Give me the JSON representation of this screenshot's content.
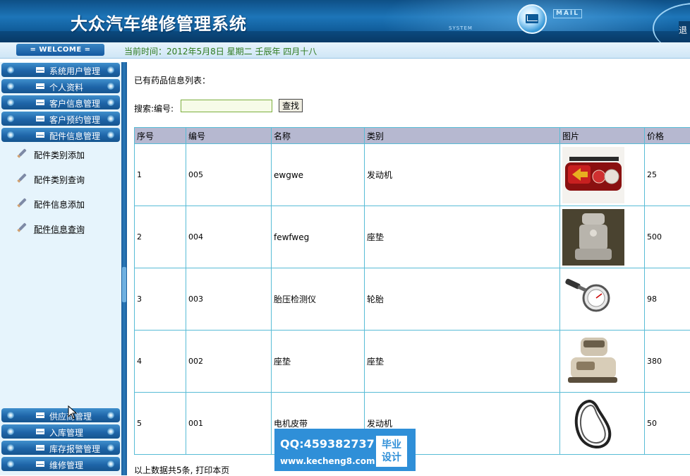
{
  "header": {
    "app_title": "大众汽车维修管理系统",
    "system_tag": "SYSTEM",
    "mail_tag": "MAIL",
    "right_tab": "退"
  },
  "status_bar": {
    "welcome": "= WELCOME =",
    "current_time": "当前时间：2012年5月8日  星期二  壬辰年  四月十八"
  },
  "sidebar": {
    "menu_top": [
      {
        "label": "系统用户管理"
      },
      {
        "label": "个人资料"
      },
      {
        "label": "客户信息管理"
      },
      {
        "label": "客户预约管理"
      },
      {
        "label": "配件信息管理"
      }
    ],
    "submenu": [
      {
        "label": "配件类别添加"
      },
      {
        "label": "配件类别查询"
      },
      {
        "label": "配件信息添加"
      },
      {
        "label": "配件信息查询"
      }
    ],
    "menu_bottom": [
      {
        "label": "供应商管理"
      },
      {
        "label": "入库管理"
      },
      {
        "label": "库存报警管理"
      },
      {
        "label": "维修管理"
      }
    ]
  },
  "content": {
    "list_title": "已有药品信息列表：",
    "search_label": "搜索:编号:",
    "search_value": "",
    "search_button": "查找",
    "table": {
      "headers": [
        "序号",
        "编号",
        "名称",
        "类别",
        "图片",
        "价格"
      ],
      "rows": [
        {
          "index": "1",
          "code": "005",
          "name": "ewgwe",
          "category": "发动机",
          "price": "25"
        },
        {
          "index": "2",
          "code": "004",
          "name": "fewfweg",
          "category": "座垫",
          "price": "500"
        },
        {
          "index": "3",
          "code": "003",
          "name": "胎压检测仪",
          "category": "轮胎",
          "price": "98"
        },
        {
          "index": "4",
          "code": "002",
          "name": "座垫",
          "category": "座垫",
          "price": "380"
        },
        {
          "index": "5",
          "code": "001",
          "name": "电机皮带",
          "category": "发动机",
          "price": "50"
        }
      ]
    },
    "summary": "以上数据共5条, 打印本页"
  },
  "watermark": {
    "qq": "QQ:459382737",
    "url": "www.kecheng8.com",
    "badge_line1": "毕业",
    "badge_line2": "设计"
  },
  "colors": {
    "header_blue": "#1d75b8",
    "menu_blue": "#1e65a8",
    "sidebar_bg": "#e6f4fc",
    "table_border": "#58bcd6",
    "table_header_bg": "#b6b8d0",
    "time_green": "#2e7a1e",
    "watermark_blue": "#2f8fd8"
  },
  "icons": {
    "menu_icon": "envelope-icon",
    "submenu_icon": "pencil-icon",
    "header_icon": "mail-icon"
  }
}
